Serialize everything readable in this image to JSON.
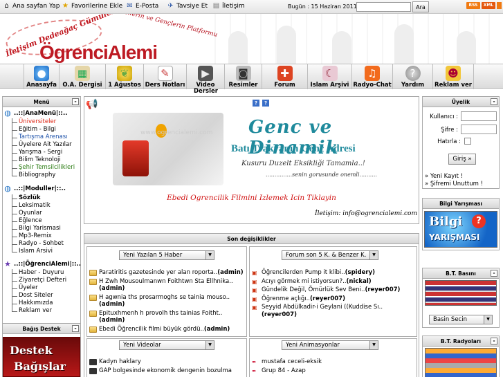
{
  "topbar": {
    "links": [
      "Ana sayfan Yap",
      "Favorilerine Ekle",
      "E-Posta",
      "Tavsiye Et",
      "İletişim"
    ],
    "date": "Bugün : 15 Haziran 2011",
    "search_button": "Ara",
    "feed_badges": [
      "RSS",
      "XML"
    ]
  },
  "header": {
    "slogan_left": "İletişim Dedeağaç Gümülcine",
    "slogan_right": "Öğrencilerin ve Gençlerin Platformu",
    "logo": "ÖgrenciAlemi"
  },
  "nav": {
    "items": [
      "Anasayfa",
      "O.A. Dergisi",
      "1 Ağustos",
      "Ders Notları",
      "Video",
      "Resimler",
      "Forum",
      "Islam Arşivi",
      "Radyo-Chat",
      "Yardım",
      "Reklam ver"
    ],
    "video_second_line": "Dersler"
  },
  "menu": {
    "title": "Menü",
    "sections": [
      {
        "title": "..::|AnaMenü|::..",
        "items": [
          {
            "label": "Üniversiteler",
            "color": "#dd2211"
          },
          {
            "label": "Eğitim - Bilgi",
            "color": "#000000"
          },
          {
            "label": "Tartışma Arenası",
            "color": "#1a4fa8"
          },
          {
            "label": "Üyelere Ait Yazılar",
            "color": "#000000"
          },
          {
            "label": "Yarışma - Sergi",
            "color": "#000000"
          },
          {
            "label": "Bilim Teknoloji",
            "color": "#000000"
          },
          {
            "label": "Şehir Temsilcilikleri",
            "color": "#2a7b12"
          },
          {
            "label": "Bibliography",
            "color": "#000000"
          }
        ]
      },
      {
        "title": "..::|Moduller|::..",
        "items": [
          {
            "label": "Sözlük",
            "color": "#000000",
            "bold": true
          },
          {
            "label": "Leksimatik",
            "color": "#000000"
          },
          {
            "label": "Oyunlar",
            "color": "#000000"
          },
          {
            "label": "Eğlence",
            "color": "#000000"
          },
          {
            "label": "Bilgi Yarismasi",
            "color": "#000000"
          },
          {
            "label": "Mp3-Remix",
            "color": "#000000"
          },
          {
            "label": "Radyo - Sohbet",
            "color": "#000000"
          },
          {
            "label": "Islam Arsivi",
            "color": "#000000"
          }
        ]
      },
      {
        "title": "..::|ÖğrenciAlemi|::..",
        "items": [
          {
            "label": "Haber - Duyuru",
            "color": "#000000"
          },
          {
            "label": "Ziyaretçi Defteri",
            "color": "#000000"
          },
          {
            "label": "Üyeler",
            "color": "#000000"
          },
          {
            "label": "Dost Siteler",
            "color": "#000000"
          },
          {
            "label": "Hakkımızda",
            "color": "#000000"
          },
          {
            "label": "Reklam ver",
            "color": "#000000"
          }
        ]
      }
    ],
    "destek_title": "Bağış Destek",
    "destek_line1": "Destek",
    "destek_line2": "Bağışlar"
  },
  "banner": {
    "title": "Genc ve Dinamik",
    "subtitle": "Batı Trakyanın Genc Adresi",
    "tagline": "Kusuru Duzelt Eksikliği Tamamla..!",
    "tagline2": "...............senin gorusunde onemli..........",
    "watermark": "www.ogrencialemi.com",
    "film_link": "Ebedi Ogrencilik Filmini Izlemek Icin Tiklayin",
    "contact": "İletişim: info@ogrencialemi.com"
  },
  "recent": {
    "title": "Son değişiklikler",
    "news_select": "Yeni Yazılan 5 Haber",
    "forum_select": "Forum son 5 K. & Benzer K.",
    "news": [
      {
        "text": "Paratiritis gazetesinde yer alan roporta..",
        "author": "(admin)"
      },
      {
        "text": "H Zwh Mousoulmanwn Foithtwn Sta Ellhnika..",
        "author": "(admin)"
      },
      {
        "text": "H agwnia ths prosarmoghs se tainia mouso..",
        "author": "(admin)"
      },
      {
        "text": "Epituxhmenh h provolh ths tainias Foitht..",
        "author": "(admin)"
      },
      {
        "text": "Ebedi Öğrencilik filmi büyük gördü..",
        "author": "(admin)"
      }
    ],
    "forum": [
      {
        "text": "Öğrencilerden Pump it klibi..",
        "author": "(spidery)"
      },
      {
        "text": "Acıyı görmek mi istiyorsun?..",
        "author": "(nickal)"
      },
      {
        "text": "Gündelik Değil, Ömürlük Sev Beni..",
        "author": "(reyer007)"
      },
      {
        "text": "Öğrenme açlığı..",
        "author": "(reyer007)"
      },
      {
        "text": "Seyyid Abdülkadir-i Geylani ((Kuddise Sı..",
        "author": "(reyer007)"
      }
    ],
    "video_select": "Yeni Videolar",
    "anim_select": "Yeni Animasyonlar",
    "videos": [
      "Kadyn haklary",
      "GAP bolgesinde ekonomik dengenin bozulma"
    ],
    "animations": [
      "mustafa ceceli-eksik",
      "Grup 84 - Azap"
    ]
  },
  "member": {
    "title": "Üyelik",
    "username_label": "Kullanıcı :",
    "password_label": "Şifre :",
    "remember_label": "Hatırla :",
    "login_button": "Giriş »",
    "new_account": "» Yeni Kayıt !",
    "forgot": "» Şifremi Unuttum !"
  },
  "quiz": {
    "title": "Bilgi Yarışması",
    "img_line1": "Bilgi",
    "img_line2": "YARIŞMASI"
  },
  "press": {
    "title": "B.T. Basını",
    "select": "Basin Secin"
  },
  "radio": {
    "title": "B.T. Radyoları"
  },
  "colors": {
    "logo_red": "#bd1a23",
    "banner_teal": "#1f8a9c",
    "link_red": "#d01111"
  }
}
